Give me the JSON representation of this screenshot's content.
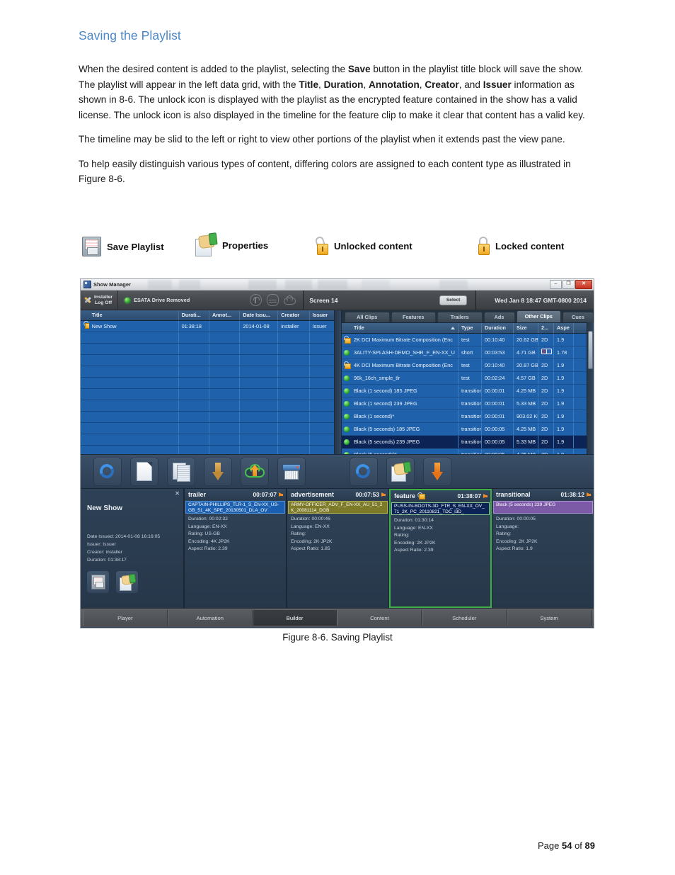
{
  "document": {
    "heading": "Saving the Playlist",
    "paragraphs": [
      "When the desired content is added to the playlist, selecting the <b>Save</b> button in the playlist title block will save the show.  The playlist will appear in the left data grid, with the <b>Title</b>, <b>Duration</b>, <b>Annotation</b>, <b>Creator</b>, and <b>Issuer</b> information as shown in 8-6.  The unlock icon is displayed with the playlist as the encrypted feature contained in the show has a valid license.  The unlock icon is also displayed in the timeline for the feature clip to make it clear that content has a valid key.",
      "The timeline may be slid to the left or right to view other portions of the playlist when it extends past the view pane.",
      "To help easily distinguish various types of content, differing colors are assigned to each content type as illustrated in Figure 8-6."
    ],
    "caption": "Figure 8-6.  Saving Playlist",
    "footer_prefix": "Page ",
    "footer_page": "54",
    "footer_mid": " of ",
    "footer_total": "89"
  },
  "legend": [
    {
      "icon": "floppy-disk-icon",
      "label": "Save Playlist"
    },
    {
      "icon": "properties-icon",
      "label": "Properties"
    },
    {
      "icon": "unlocked-padlock-icon",
      "label": "Unlocked content"
    },
    {
      "icon": "locked-padlock-icon",
      "label": "Locked content"
    }
  ],
  "app": {
    "window_title": "Show Manager",
    "window_buttons": {
      "minimize": "–",
      "maximize": "❐",
      "close": "✕"
    },
    "header": {
      "user_line1": "Installer",
      "user_line2": "Log Off",
      "status_text": "ESATA Drive Removed",
      "status_color": "#2fd13a",
      "screen_label": "Screen 14",
      "select_button": "Select",
      "datetime": "Wed Jan 8 18:47 GMT-0800 2014"
    },
    "playlist_grid": {
      "columns": [
        "Title",
        "Durati...",
        "Annot...",
        "Date Issu...",
        "Creator",
        "Issuer"
      ],
      "rows": [
        {
          "locked": false,
          "title": "New Show",
          "duration": "01:38:18",
          "annotation": "",
          "date_issued": "2014-01-08",
          "creator": "installer",
          "issuer": "Issuer"
        }
      ],
      "empty_rows": 11
    },
    "content_tabs": [
      {
        "label": "All Clips",
        "active": false
      },
      {
        "label": "Features",
        "active": false
      },
      {
        "label": "Trailers",
        "active": false
      },
      {
        "label": "Ads",
        "active": false,
        "small": true
      },
      {
        "label": "Other Clips",
        "active": true
      },
      {
        "label": "Cues",
        "active": false,
        "small": true
      }
    ],
    "content_grid": {
      "columns": [
        "Title",
        "Type",
        "Duration",
        "Size",
        "2...",
        "Aspe"
      ],
      "rows": [
        {
          "status": "lock",
          "title": "2K DCI Maximum Bitrate Composition (Enc",
          "type": "test",
          "duration": "00:10:40",
          "size": "20.62 GB",
          "dim": "2D",
          "aspect": "1.9",
          "selected": false
        },
        {
          "status": "green",
          "title": "3ALITY-SPLASH-DEMO_SHR_F_EN-XX_U",
          "type": "short",
          "duration": "00:03:53",
          "size": "4.71 GB",
          "dim": "3D",
          "aspect": "1.78",
          "selected": false
        },
        {
          "status": "lock",
          "title": "4K DCI Maximum Bitrate Composition (Enc",
          "type": "test",
          "duration": "00:10:40",
          "size": "20.87 GB",
          "dim": "2D",
          "aspect": "1.9",
          "selected": false
        },
        {
          "status": "green",
          "title": "96k_16ch_smple_tlr",
          "type": "test",
          "duration": "00:02:24",
          "size": "4.57 GB",
          "dim": "2D",
          "aspect": "1.9",
          "selected": false
        },
        {
          "status": "green",
          "title": "Black (1 second) 185 JPEG",
          "type": "transition",
          "duration": "00:00:01",
          "size": "4.25 MB",
          "dim": "2D",
          "aspect": "1.9",
          "selected": false
        },
        {
          "status": "green",
          "title": "Black (1 second) 239 JPEG",
          "type": "transition",
          "duration": "00:00:01",
          "size": "5.33 MB",
          "dim": "2D",
          "aspect": "1.9",
          "selected": false
        },
        {
          "status": "green",
          "title": "Black (1 second)*",
          "type": "transition",
          "duration": "00:00:01",
          "size": "903.02 KB",
          "dim": "2D",
          "aspect": "1.9",
          "selected": false
        },
        {
          "status": "green",
          "title": "Black (5 seconds) 185 JPEG",
          "type": "transition",
          "duration": "00:00:05",
          "size": "4.25 MB",
          "dim": "2D",
          "aspect": "1.9",
          "selected": false
        },
        {
          "status": "green",
          "title": "Black (5 seconds) 239 JPEG",
          "type": "transition",
          "duration": "00:00:05",
          "size": "5.33 MB",
          "dim": "2D",
          "aspect": "1.9",
          "selected": true
        },
        {
          "status": "green",
          "title": "Black (5 seconds)*",
          "type": "transition",
          "duration": "00:00:05",
          "size": "4.25 MB",
          "dim": "2D",
          "aspect": "1.9",
          "selected": false
        }
      ]
    },
    "toolbar_left": [
      {
        "icon": "refresh-icon"
      },
      {
        "icon": "new-page-icon"
      },
      {
        "icon": "copy-pages-icon"
      },
      {
        "icon": "download-arrow-icon"
      },
      {
        "icon": "cloud-upload-icon"
      },
      {
        "icon": "shredder-icon"
      }
    ],
    "toolbar_right": [
      {
        "icon": "refresh-icon"
      },
      {
        "icon": "properties-icon"
      },
      {
        "icon": "add-down-arrow-icon"
      }
    ],
    "timeline": {
      "show": {
        "title": "New Show",
        "close": "✕",
        "date_issued": "Date Issued: 2014-01-08 16:16:05",
        "issuer": "Issuer: Issuer",
        "creator": "Creator: installer",
        "duration": "Duration: 01:38:17",
        "save_button": "save-playlist-button",
        "properties_button": "properties-button"
      },
      "clips": [
        {
          "kind": "trailer",
          "label": "trailer",
          "timecode": "00:07:07",
          "clip_name": "CAPTAIN-PHILLIPS_TLR-1_S_EN-XX_US-GB_51_4K_SPE_20130501_DLA_OV",
          "duration": "Duration: 00:02:32",
          "language": "Language: EN-XX",
          "rating": "Rating: US-GB",
          "encoding": "Encoding: 4K JP2K",
          "aspect": "Aspect Ratio: 2.39",
          "color": "#1b5fb0",
          "locked": false,
          "selected": false
        },
        {
          "kind": "advertisement",
          "label": "advertisement",
          "timecode": "00:07:53",
          "clip_name": "ARMY-OFFICER_ADV_F_EN-XX_AU_51_2K_20081114_DGB",
          "duration": "Duration: 00:00:46",
          "language": "Language: EN-XX",
          "rating": "Rating:",
          "encoding": "Encoding: 2K JP2K",
          "aspect": "Aspect Ratio: 1.85",
          "color": "#7d7a28",
          "locked": false,
          "selected": false
        },
        {
          "kind": "feature",
          "label": "feature",
          "timecode": "01:38:07",
          "clip_name": "PUSS-IN-BOOTS-3D_FTR_S_EN-XX_OV_71_2K_PC_20110821_TDC_i3D_",
          "duration": "Duration: 01:30:14",
          "language": "Language: EN-XX",
          "rating": "Rating:",
          "encoding": "Encoding: 2K JP2K",
          "aspect": "Aspect Ratio: 2.39",
          "color": "#0b2455",
          "locked": true,
          "selected": true
        },
        {
          "kind": "transitional",
          "label": "transitional",
          "timecode": "01:38:12",
          "clip_name": "Black (5 seconds) 239 JPEG",
          "duration": "Duration: 00:00:05",
          "language": "Language:",
          "rating": "Rating:",
          "encoding": "Encoding: 2K JP2K",
          "aspect": "Aspect Ratio: 1.9",
          "color": "#7d5aa8",
          "locked": false,
          "selected": false
        }
      ]
    },
    "bottom_nav": [
      {
        "label": "Player",
        "active": false
      },
      {
        "label": "Automation",
        "active": false
      },
      {
        "label": "Builder",
        "active": true
      },
      {
        "label": "Content",
        "active": false
      },
      {
        "label": "Scheduler",
        "active": false
      },
      {
        "label": "System",
        "active": false
      }
    ]
  }
}
